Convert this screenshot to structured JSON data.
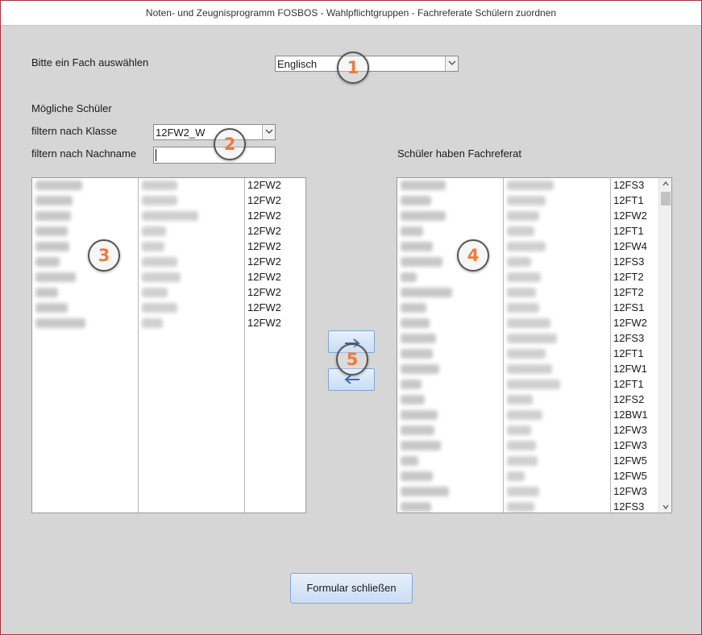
{
  "window": {
    "title": "Noten- und Zeugnisprogramm FOSBOS - Wahlpflichtgruppen - Fachreferate Schülern zuordnen"
  },
  "fach": {
    "label": "Bitte ein Fach auswählen",
    "value": "Englisch"
  },
  "moegliche": {
    "heading": "Mögliche Schüler",
    "filter_klasse_label": "filtern nach Klasse",
    "filter_klasse_value": "12FW2_W",
    "filter_name_label": "filtern nach Nachname",
    "filter_name_value": "",
    "klassen": [
      "12FW2",
      "12FW2",
      "12FW2",
      "12FW2",
      "12FW2",
      "12FW2",
      "12FW2",
      "12FW2",
      "12FW2",
      "12FW2"
    ]
  },
  "haben": {
    "heading": "Schüler haben Fachreferat",
    "klassen": [
      "12FS3",
      "12FT1",
      "12FW2",
      "12FT1",
      "12FW4",
      "12FS3",
      "12FT2",
      "12FT2",
      "12FS1",
      "12FW2",
      "12FS3",
      "12FT1",
      "12FW1",
      "12FT1",
      "12FS2",
      "12BW1",
      "12FW3",
      "12FW3",
      "12FW5",
      "12FW5",
      "12FW3",
      "12FS3"
    ]
  },
  "buttons": {
    "close_label": "Formular schließen",
    "add_icon": "arrow-right-icon",
    "remove_icon": "arrow-left-icon"
  },
  "badges": [
    "1",
    "2",
    "3",
    "4",
    "5"
  ],
  "colors": {
    "badge": "#f07a3c",
    "frame": "#a8323e",
    "button": "#c9ddf4"
  }
}
